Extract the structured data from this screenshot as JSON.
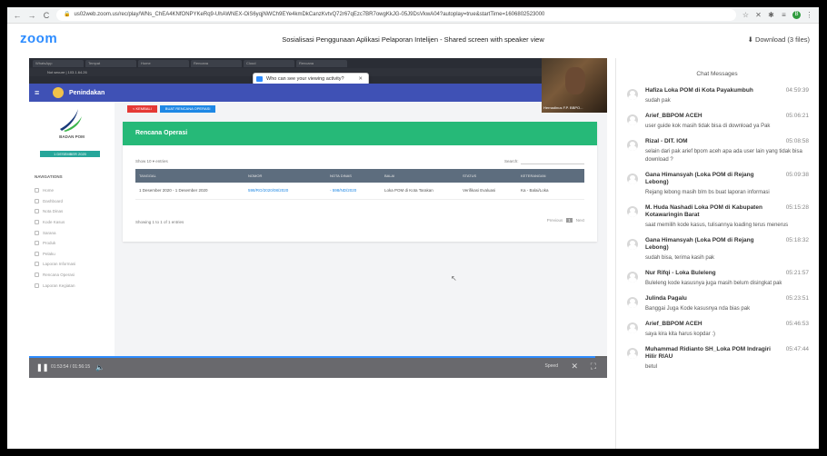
{
  "browser": {
    "url": "us02web.zoom.us/rec/play/WNs_ChEA4KNfONPYKeRq9-UhAWNEX-OiS6yqjNWCh9EYe4kmDkCanzKvtvQ72r67qEzc7BR7owgKkJG-05J9DsVkwA04?autoplay=true&startTime=1606802523000",
    "icons": [
      "back-icon",
      "forward-icon",
      "reload-icon"
    ],
    "ext_labels": [
      "☆",
      "✕",
      "✱",
      "≡",
      "B",
      "⋮"
    ]
  },
  "zoom": {
    "logo": "zoom",
    "title": "Sosialisasi Penggunaan Aplikasi Pelaporan Intelijen - Shared screen with speaker view",
    "download": "Download (3 files)"
  },
  "video": {
    "tooltip": "Who can see your viewing activity?",
    "speaker_name": "Hernadinus F.P. BBPO...",
    "app": {
      "name": "Penindakan",
      "bpom_text": "BADAN POM",
      "date_badge": "1 DESEMBER 2020",
      "nav_title": "NAVIGATIONS",
      "nav_items": [
        "Home",
        "Dashboard",
        "Nota Dinas",
        "Kode Kasus",
        "Sarana",
        "Produk",
        "Pelaku",
        "Laporan Informasi",
        "Rencana Operasi",
        "Laporan Kegiatan"
      ],
      "buttons": {
        "back": "< KEMBALI",
        "create": "BUAT RENCANA OPERASI"
      },
      "panel_title": "Rencana Operasi",
      "show_entries": "Show  10  ▾  entries",
      "search_label": "Search:",
      "table": {
        "headers": [
          "TANGGAL",
          "NOMOR",
          "NOTA DINAS",
          "BALAI",
          "STATUS",
          "KETERANGAN"
        ],
        "rows": [
          [
            "1 Desember 2020 - 1 Desember 2020",
            "598/RO/2020/08/2020",
            "- 598/ND/2020",
            "Loka POM di Kota Tarakan",
            "Verifikasi Evaluasi",
            "Ka - Balai/Loka"
          ]
        ]
      },
      "showing": "Showing 1 to 1 of 1 entries",
      "pager": {
        "prev": "Previous",
        "current": "1",
        "next": "Next"
      }
    },
    "player": {
      "time": "01:53:54 / 01:56:15",
      "speed": "Speed",
      "progress": 0.98
    }
  },
  "chat": {
    "title": "Chat Messages",
    "messages": [
      {
        "sender": "Hafiza Loka POM di Kota Payakumbuh",
        "time": "04:59:39",
        "text": "sudah pak"
      },
      {
        "sender": "Arief_BBPOM ACEH",
        "time": "05:06:21",
        "text": "user guide kok masih tidak bisa di download ya Pak"
      },
      {
        "sender": "Rizal - DIT. IOM",
        "time": "05:08:58",
        "text": "selain dari pak arief bpom aceh apa ada user lain yang tidak bisa download ?"
      },
      {
        "sender": "Gana Himansyah (Loka POM di Rejang Lebong)",
        "time": "05:09:38",
        "text": "Rejang lebong masih blm bs buat laporan informasi"
      },
      {
        "sender": "M. Huda Nashadi Loka POM di Kabupaten Kotawaringin Barat",
        "time": "05:15:28",
        "text": "saat memilih kode kasus, tulisannya loading terus menerus"
      },
      {
        "sender": "Gana Himansyah (Loka POM di Rejang Lebong)",
        "time": "05:18:32",
        "text": "sudah bisa, terima kasih pak"
      },
      {
        "sender": "Nur Rifqi - Loka Buleleng",
        "time": "05:21:57",
        "text": "Buleleng kode kasusnya juga masih belum disingkat pak"
      },
      {
        "sender": "Julinda Pagalu",
        "time": "05:23:51",
        "text": "Banggai Juga Kode kasusnya nda bias pak"
      },
      {
        "sender": "Arief_BBPOM ACEH",
        "time": "05:46:53",
        "text": "saya kira kita harus kopdar :)"
      },
      {
        "sender": "Muhammad Ridianto SH_Loka POM Indragiri Hilir RIAU",
        "time": "05:47:44",
        "text": "betul"
      }
    ]
  }
}
